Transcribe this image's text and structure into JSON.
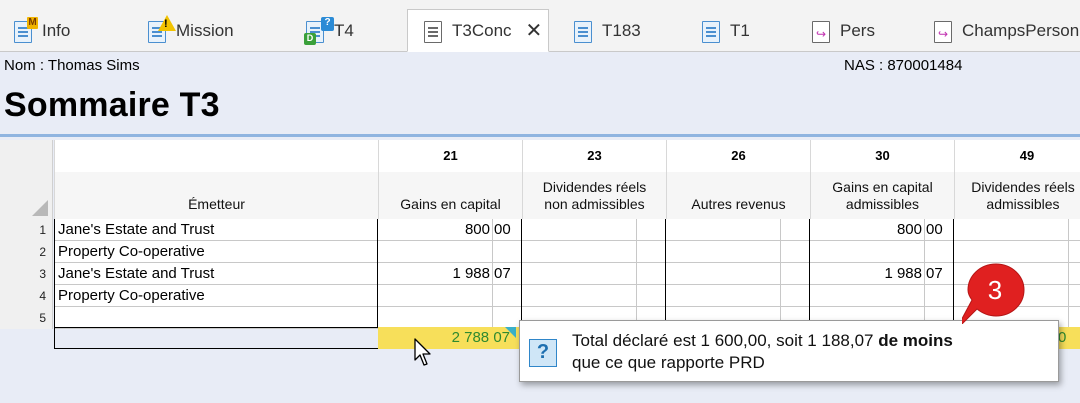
{
  "tabs": [
    {
      "label": "Info",
      "icon": "document-m-icon"
    },
    {
      "label": "Mission",
      "icon": "document-warning-icon"
    },
    {
      "label": "T4",
      "icon": "document-question-icon"
    },
    {
      "label": "T3Conc",
      "icon": "document-plain-icon",
      "active": true
    },
    {
      "label": "T183",
      "icon": "document-icon"
    },
    {
      "label": "T1",
      "icon": "document-icon"
    },
    {
      "label": "Pers",
      "icon": "document-arrow-icon"
    },
    {
      "label": "ChampsPerson",
      "icon": "document-arrow-icon"
    }
  ],
  "header": {
    "nom": "Nom : Thomas Sims",
    "nas": "NAS : 870001484",
    "title": "Sommaire T3"
  },
  "columns": [
    {
      "num": "",
      "label": "Émetteur"
    },
    {
      "num": "21",
      "label": "Gains en capital"
    },
    {
      "num": "23",
      "label": "Dividendes réels non admissibles"
    },
    {
      "num": "26",
      "label": "Autres revenus"
    },
    {
      "num": "30",
      "label": "Gains en capital admissibles"
    },
    {
      "num": "49",
      "label": "Dividendes réels admissibles"
    }
  ],
  "rows": [
    {
      "n": "1",
      "emetteur": "Jane's Estate and Trust",
      "c21_int": "800",
      "c21_dec": "00",
      "c30_int": "800",
      "c30_dec": "00"
    },
    {
      "n": "2",
      "emetteur": "Property Co-operative",
      "c21_int": "",
      "c21_dec": "",
      "c30_int": "",
      "c30_dec": ""
    },
    {
      "n": "3",
      "emetteur": "Jane's Estate and Trust",
      "c21_int": "1 988",
      "c21_dec": "07",
      "c30_int": "1 988",
      "c30_dec": "07"
    },
    {
      "n": "4",
      "emetteur": "Property Co-operative",
      "c21_int": "",
      "c21_dec": "",
      "c30_int": "",
      "c30_dec": ""
    },
    {
      "n": "5",
      "emetteur": "",
      "c21_int": "",
      "c21_dec": "",
      "c30_int": "",
      "c30_dec": ""
    }
  ],
  "totals": {
    "c21": "2 788 07",
    "right_partial": "0 00"
  },
  "tooltip": {
    "line1_a": "Total déclaré est 1 600,00, soit 1 188,07 ",
    "line1_b": "de moins",
    "line2": "que ce que rapporte PRD",
    "icon": "question-icon"
  },
  "callout": {
    "number": "3",
    "color": "#e02020"
  },
  "colors": {
    "accent_rule": "#8fb4e0",
    "total_fill": "#f7df5a",
    "total_text": "#2f8a2f"
  }
}
